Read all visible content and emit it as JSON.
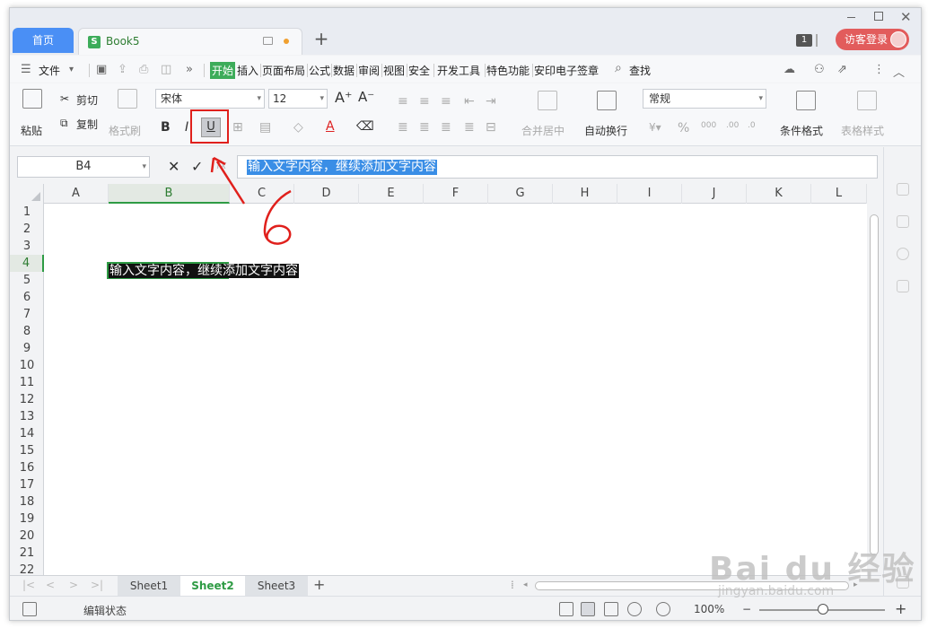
{
  "titlebar": {
    "home_tab": "首页",
    "doc_tab": "Book5",
    "doc_icon": "S",
    "add_tab": "+",
    "badge": "1",
    "login": "访客登录"
  },
  "menu": {
    "file": "文件",
    "tabs": [
      "开始",
      "插入",
      "页面布局",
      "公式",
      "数据",
      "审阅",
      "视图",
      "安全",
      "开发工具",
      "特色功能",
      "安印电子签章"
    ],
    "active_tab": "开始",
    "search": "查找"
  },
  "ribbon": {
    "paste": "粘贴",
    "cut": "剪切",
    "copy": "复制",
    "format_painter": "格式刷",
    "font_name": "宋体",
    "font_size": "12",
    "bold": "B",
    "italic": "I",
    "underline": "U",
    "font_color": "A",
    "merge": "合并居中",
    "wrap": "自动换行",
    "number_format": "常规",
    "percent": "%",
    "conditional": "条件格式",
    "table_style": "表格样式"
  },
  "formula_bar": {
    "name_box": "B4",
    "fx": "fx",
    "content": "输入文字内容，继续添加文字内容"
  },
  "grid": {
    "columns": [
      "A",
      "B",
      "C",
      "D",
      "E",
      "F",
      "G",
      "H",
      "I",
      "J",
      "K",
      "L"
    ],
    "selected_column": "B",
    "rows": [
      "1",
      "2",
      "3",
      "4",
      "5",
      "6",
      "7",
      "8",
      "9",
      "10",
      "11",
      "12",
      "13",
      "14",
      "15",
      "16",
      "17",
      "18",
      "19",
      "20",
      "21",
      "22"
    ],
    "selected_row": "4",
    "cell_b4": "输入文字内容，继续添加文字内容"
  },
  "sheets": {
    "tabs": [
      "Sheet1",
      "Sheet2",
      "Sheet3"
    ],
    "active": "Sheet2",
    "add": "+"
  },
  "status": {
    "mode": "编辑状态",
    "zoom": "100%"
  },
  "annotation": {
    "number": "6",
    "color": "#e0201c"
  },
  "watermark": {
    "big": "Bai du 经验",
    "small": "jingyan.baidu.com"
  }
}
